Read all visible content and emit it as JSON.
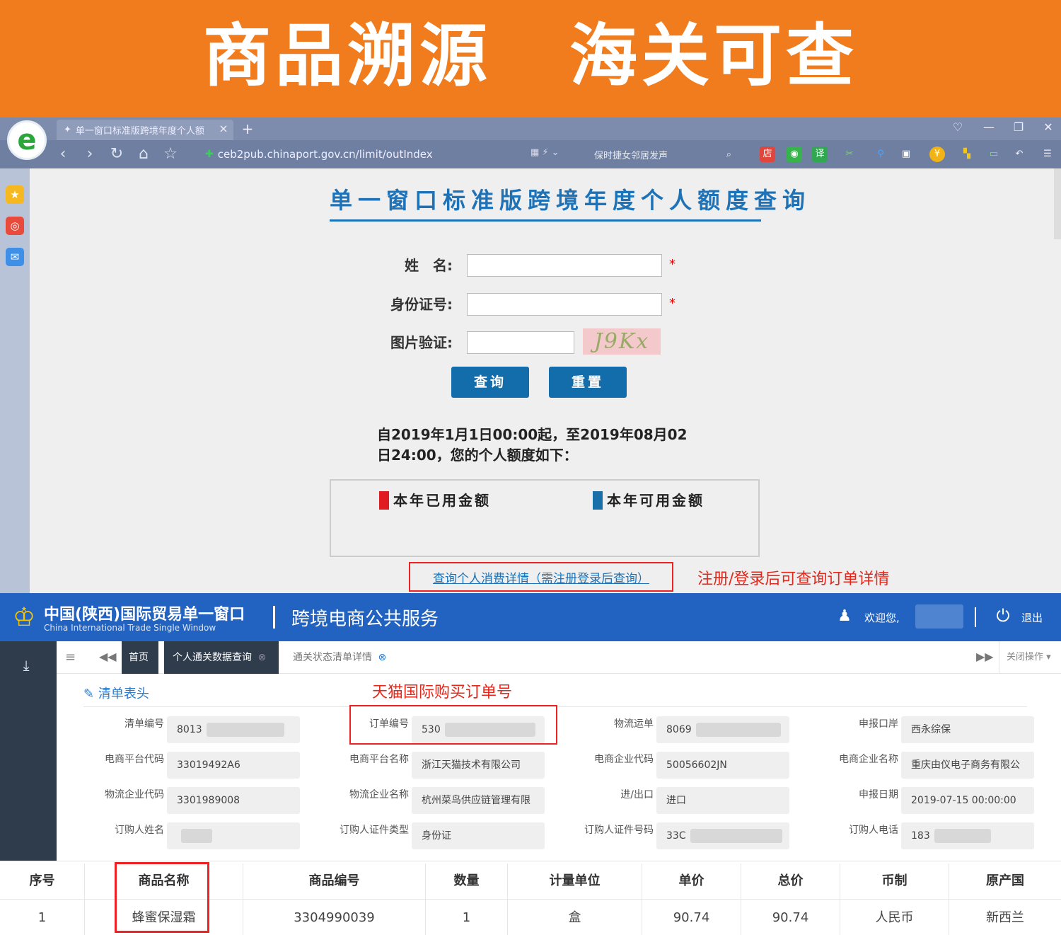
{
  "banner": {
    "left": "商品溯源",
    "right": "海关可查"
  },
  "browser": {
    "tab_title": "单一窗口标准版跨境年度个人额",
    "tab_close": "×",
    "tab_new": "+",
    "url": "ceb2pub.chinaport.gov.cn/limit/outIndex",
    "search_text": "保时捷女邻居发声",
    "logo_letter": "e"
  },
  "query_page": {
    "title": "单一窗口标准版跨境年度个人额度查询",
    "name_label": "姓　名:",
    "id_label": "身份证号:",
    "captcha_label": "图片验证:",
    "required_mark": "*",
    "captcha_text": "J9Kx",
    "search_button": "查询",
    "reset_button": "重置",
    "notice": "自2019年1月1日00:00起，至2019年08月02日24:00，您的个人额度如下：",
    "legend_used": "本年已用金额",
    "legend_available": "本年可用金额",
    "detail_link": "查询个人消费详情（需注册登录后查询）",
    "detail_note": "注册/登录后可查询订单详情",
    "colors": {
      "used": "#e11b22",
      "available": "#1a6fa8"
    }
  },
  "portal": {
    "org_cn": "中国(陕西)国际贸易单一窗口",
    "org_en": "China International Trade Single Window",
    "service_title": "跨境电商公共服务",
    "welcome": "欢迎您,",
    "logout": "退出",
    "tabs": {
      "home": "首页",
      "customs_query": "个人通关数据查询",
      "status_detail": "通关状态清单详情"
    },
    "close_ops": "关闭操作",
    "section_title": "清单表头",
    "tmall_note": "天猫国际购买订单号",
    "fields": {
      "list_no": {
        "label": "清单编号",
        "value": "8013"
      },
      "order_no": {
        "label": "订单编号",
        "value": "530"
      },
      "logistics_no": {
        "label": "物流运单",
        "value": "8069"
      },
      "port": {
        "label": "申报口岸",
        "value": "西永综保"
      },
      "platform_code": {
        "label": "电商平台代码",
        "value": "33019492A6"
      },
      "platform_name": {
        "label": "电商平台名称",
        "value": "浙江天猫技术有限公司"
      },
      "ent_code": {
        "label": "电商企业代码",
        "value": "50056602JN"
      },
      "ent_name": {
        "label": "电商企业名称",
        "value": "重庆由仪电子商务有限公"
      },
      "log_code": {
        "label": "物流企业代码",
        "value": "3301989008"
      },
      "log_name": {
        "label": "物流企业名称",
        "value": "杭州菜鸟供应链管理有限"
      },
      "io": {
        "label": "进/出口",
        "value": "进口"
      },
      "decl_date": {
        "label": "申报日期",
        "value": "2019-07-15 00:00:00"
      },
      "buyer_name": {
        "label": "订购人姓名",
        "value": ""
      },
      "buyer_id_type": {
        "label": "订购人证件类型",
        "value": "身份证"
      },
      "buyer_id_no": {
        "label": "订购人证件号码",
        "value": "33C"
      },
      "buyer_phone": {
        "label": "订购人电话",
        "value": "183"
      }
    }
  },
  "goods_table": {
    "headers": [
      "序号",
      "商品名称",
      "商品编号",
      "数量",
      "计量单位",
      "单价",
      "总价",
      "币制",
      "原产国"
    ],
    "rows": [
      [
        "1",
        "蜂蜜保湿霜",
        "3304990039",
        "1",
        "盒",
        "90.74",
        "90.74",
        "人民币",
        "新西兰"
      ]
    ]
  }
}
